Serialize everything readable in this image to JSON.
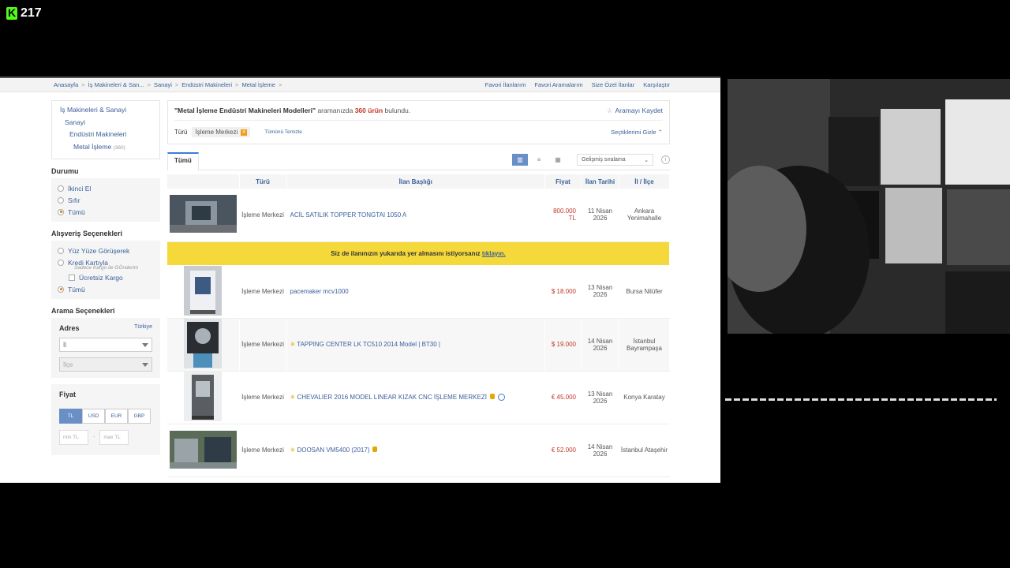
{
  "overlay": {
    "viewer_count": "217"
  },
  "breadcrumbs": [
    "Anasayfa",
    "İş Makineleri & San...",
    "Sanayi",
    "Endüstri Makineleri",
    "Metal İşleme"
  ],
  "top_links": [
    "Favori İlanlarım",
    "Favori Aramalarım",
    "Size Özel İlanlar",
    "Karşılaştır"
  ],
  "categories": {
    "l1": "İş Makineleri & Sanayi",
    "l2": "Sanayi",
    "l3": "Endüstri Makineleri",
    "l4": "Metal İşleme",
    "l4_count": "(360)"
  },
  "condition": {
    "title": "Durumu",
    "options": [
      "İkinci El",
      "Sıfır",
      "Tümü"
    ]
  },
  "shopping": {
    "title": "Alışveriş Seçenekleri",
    "face_to_face": "Yüz Yüze Görüşerek",
    "credit_card": "Kredi Kartıyla",
    "credit_note": "Sadece Kargo ile GÖnderim",
    "free_shipping": "Ücretsiz Kargo",
    "all": "Tümü"
  },
  "search_options": {
    "title": "Arama Seçenekleri",
    "address_label": "Adres",
    "country": "Türkiye",
    "city_placeholder": "İl",
    "district_placeholder": "İlçe"
  },
  "price": {
    "title": "Fiyat",
    "currencies": [
      "TL",
      "USD",
      "EUR",
      "GBP"
    ],
    "min_placeholder": "min TL",
    "max_placeholder": "max TL"
  },
  "result": {
    "query": "\"Metal İşleme Endüstri Makineleri Modelleri\"",
    "text_mid": "aramanızda",
    "count": "360 ürün",
    "text_end": "bulundu.",
    "save_search": "Aramayı Kaydet",
    "filter_label": "Türü",
    "filter_value": "İşleme Merkezi",
    "clear_all": "Tümünü Temizle",
    "hide_selected": "Seçtiklerimi Gizle"
  },
  "tabs": {
    "all": "Tümü"
  },
  "sort": {
    "selected": "Gelişmiş sıralama"
  },
  "table": {
    "headers": [
      "",
      "Türü",
      "İlan Başlığı",
      "Fiyat",
      "İlan Tarihi",
      "İl / İlçe"
    ],
    "ad_text": "Siz de ilanınızın yukarıda yer almasını istiyorsanız",
    "ad_link": "tıklayın.",
    "rows": [
      {
        "type": "İşleme Merkezi",
        "title": "ACİL SATILIK TOPPER TONGTAI 1050 A",
        "price": "800.000 TL",
        "date": "11 Nisan 2026",
        "location": "Ankara Yenimahalle"
      },
      {
        "type": "İşleme Merkezi",
        "title": "pacemaker mcv1000",
        "price": "$ 18.000",
        "date": "13 Nisan 2026",
        "location": "Bursa Nilüfer"
      },
      {
        "type": "İşleme Merkezi",
        "title": "TAPPING CENTER LK TC510 2014 Model | BT30 |",
        "price": "$ 19.000",
        "date": "14 Nisan 2026",
        "location": "İstanbul Bayrampaşa"
      },
      {
        "type": "İşleme Merkezi",
        "title": "CHEVALIER 2016 MODEL LINEAR KIZAK CNC İŞLEME MERKEZİ",
        "price": "€ 45.000",
        "date": "13 Nisan 2026",
        "location": "Konya Karatay"
      },
      {
        "type": "İşleme Merkezi",
        "title": "DOOSAN VM5400 (2017)",
        "price": "€ 52.000",
        "date": "14 Nisan 2026",
        "location": "İstanbul Ataşehir"
      }
    ]
  }
}
